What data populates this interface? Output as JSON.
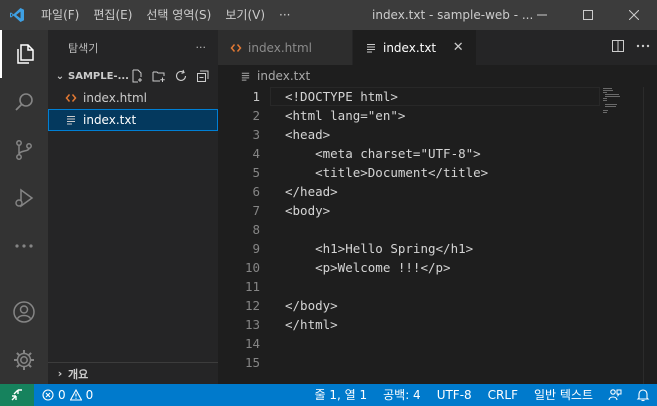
{
  "menu": [
    "파일(F)",
    "편집(E)",
    "선택 영역(S)",
    "보기(V)",
    "···"
  ],
  "window_title": "index.txt - sample-web - ...",
  "sidebar": {
    "title": "탐색기",
    "more": "···",
    "project": "SAMPLE-...",
    "files": [
      {
        "name": "index.html",
        "icon": "html-file-icon"
      },
      {
        "name": "index.txt",
        "icon": "text-file-icon"
      }
    ],
    "outline": "개요"
  },
  "tabs": [
    {
      "label": "index.html",
      "active": false
    },
    {
      "label": "index.txt",
      "active": true
    }
  ],
  "breadcrumb": "index.txt",
  "editor": {
    "current_line": 1,
    "lines": [
      "<!DOCTYPE html>",
      "<html lang=\"en\">",
      "<head>",
      "    <meta charset=\"UTF-8\">",
      "    <title>Document</title>",
      "</head>",
      "<body>",
      "",
      "    <h1>Hello Spring</h1>",
      "    <p>Welcome !!!</p>",
      "",
      "</body>",
      "</html>",
      "",
      ""
    ],
    "line_numbers": [
      "1",
      "2",
      "3",
      "4",
      "5",
      "6",
      "7",
      "8",
      "9",
      "10",
      "11",
      "12",
      "13",
      "14",
      "15"
    ]
  },
  "status": {
    "errors": "0",
    "warnings": "0",
    "position": "줄 1, 열 1",
    "spaces": "공백: 4",
    "encoding": "UTF-8",
    "eol": "CRLF",
    "language": "일반 텍스트"
  },
  "colors": {
    "accent": "#007acc",
    "remote": "#16825d",
    "html_icon": "#e37933",
    "selection": "#04395e"
  }
}
